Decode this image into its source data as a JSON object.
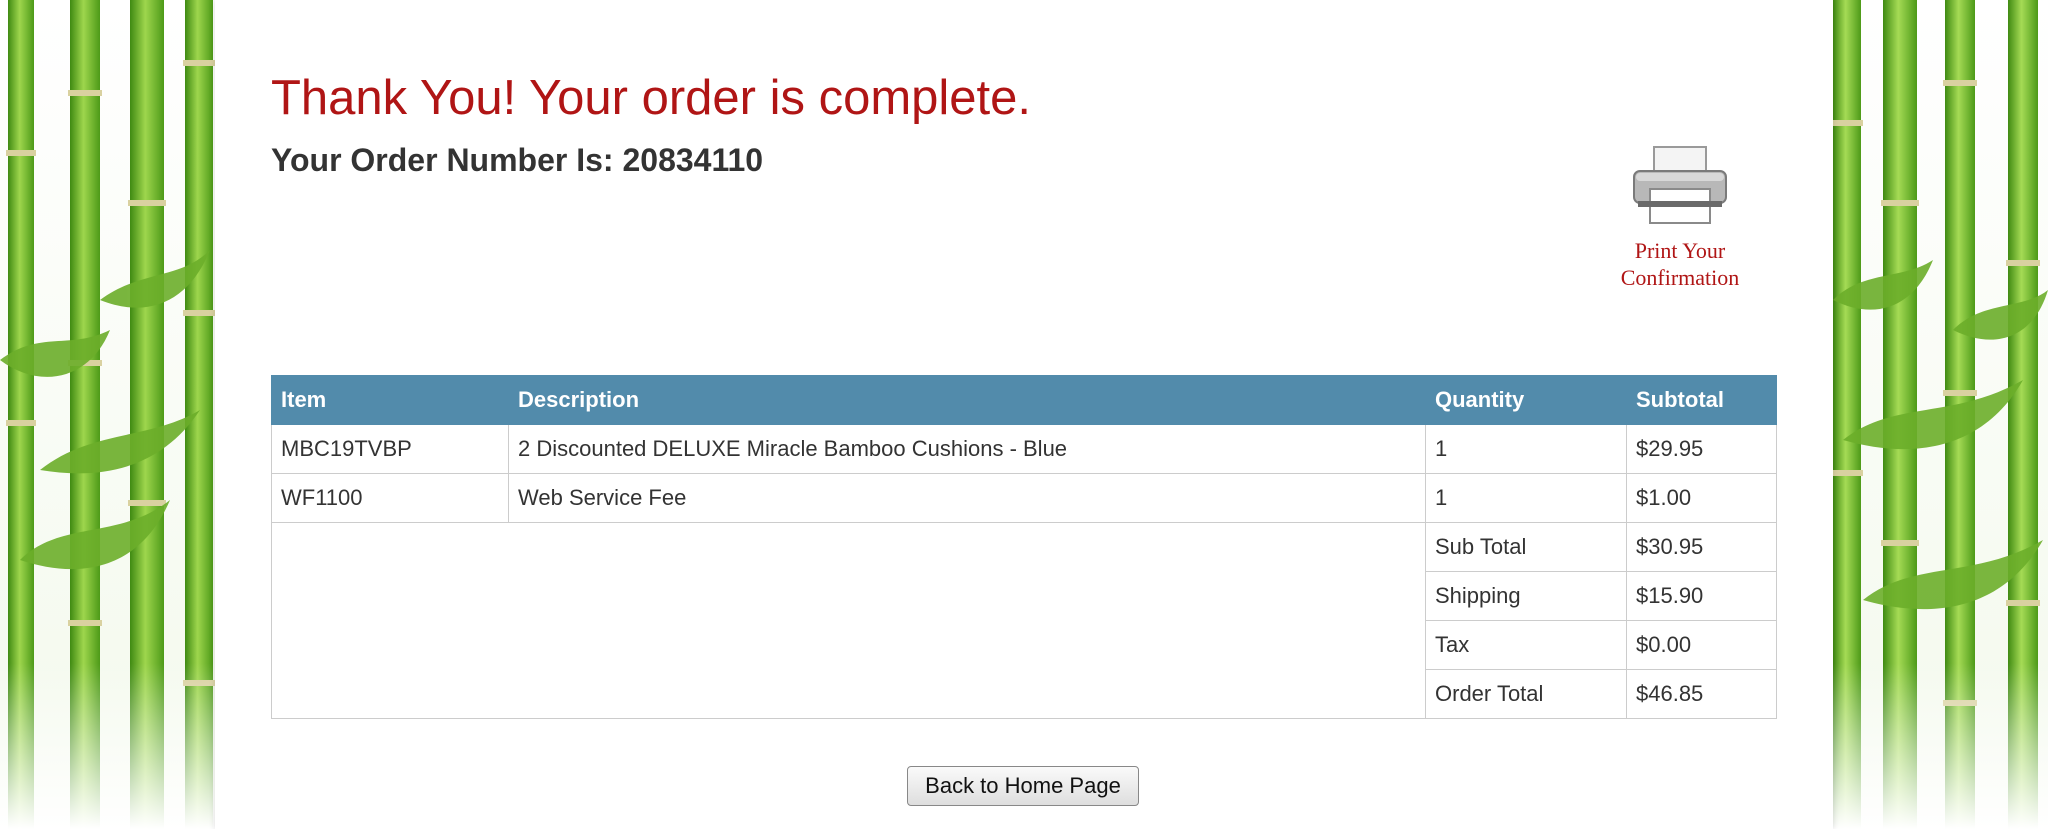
{
  "heading": "Thank You! Your order is complete.",
  "order_number_text": "Your Order Number Is: 20834110",
  "print": {
    "label": "Print Your\nConfirmation",
    "icon": "printer-icon"
  },
  "table": {
    "headers": {
      "item": "Item",
      "description": "Description",
      "quantity": "Quantity",
      "subtotal": "Subtotal"
    },
    "rows": [
      {
        "item": "MBC19TVBP",
        "description": "2 Discounted DELUXE Miracle Bamboo Cushions - Blue",
        "quantity": "1",
        "subtotal": "$29.95"
      },
      {
        "item": "WF1100",
        "description": "Web Service Fee",
        "quantity": "1",
        "subtotal": "$1.00"
      }
    ],
    "totals": [
      {
        "label": "Sub Total",
        "value": "$30.95"
      },
      {
        "label": "Shipping",
        "value": "$15.90"
      },
      {
        "label": "Tax",
        "value": "$0.00"
      },
      {
        "label": "Order Total",
        "value": "$46.85"
      }
    ]
  },
  "back_button": "Back to Home Page",
  "colors": {
    "heading": "#b01515",
    "table_header": "#528bab",
    "bamboo": "#6cae2a"
  }
}
